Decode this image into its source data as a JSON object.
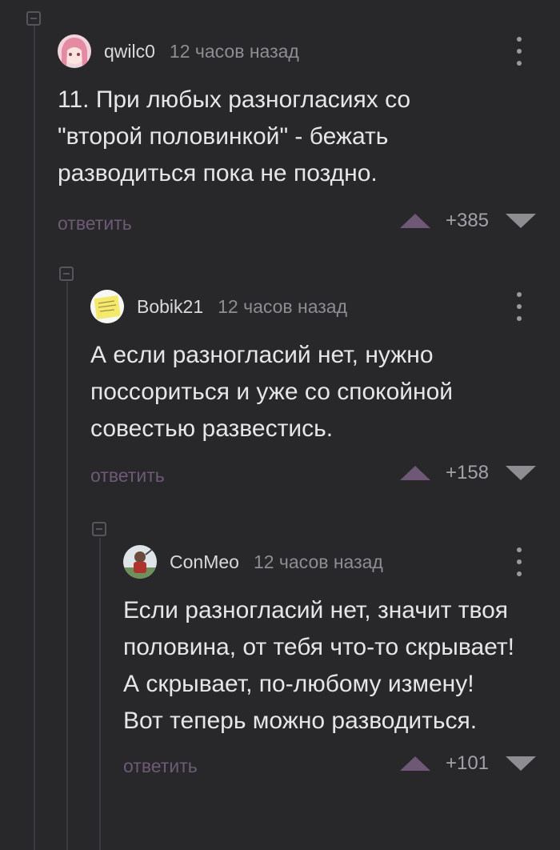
{
  "comments": [
    {
      "author": "qwilc0",
      "time": "12 часов назад",
      "text": "11. При любых разногласиях со \"второй половинкой\" - бежать разводиться пока не поздно.",
      "reply_label": "ответить",
      "score": "+385"
    },
    {
      "author": "Bobik21",
      "time": "12 часов назад",
      "text": "А если разногласий нет, нужно поссориться и уже со спокойной совестью развестись.",
      "reply_label": "ответить",
      "score": "+158"
    },
    {
      "author": "ConMeo",
      "time": "12 часов назад",
      "text": "Если разногласий нет, значит твоя половина, от тебя что-то скрывает!  А скрывает, по-любому измену!\nВот теперь можно разводиться.",
      "reply_label": "ответить",
      "score": "+101"
    }
  ],
  "colors": {
    "background": "#28282b",
    "reply_link": "#6e5a75",
    "upvote": "#6f5776",
    "downvote": "#8d8d92"
  }
}
